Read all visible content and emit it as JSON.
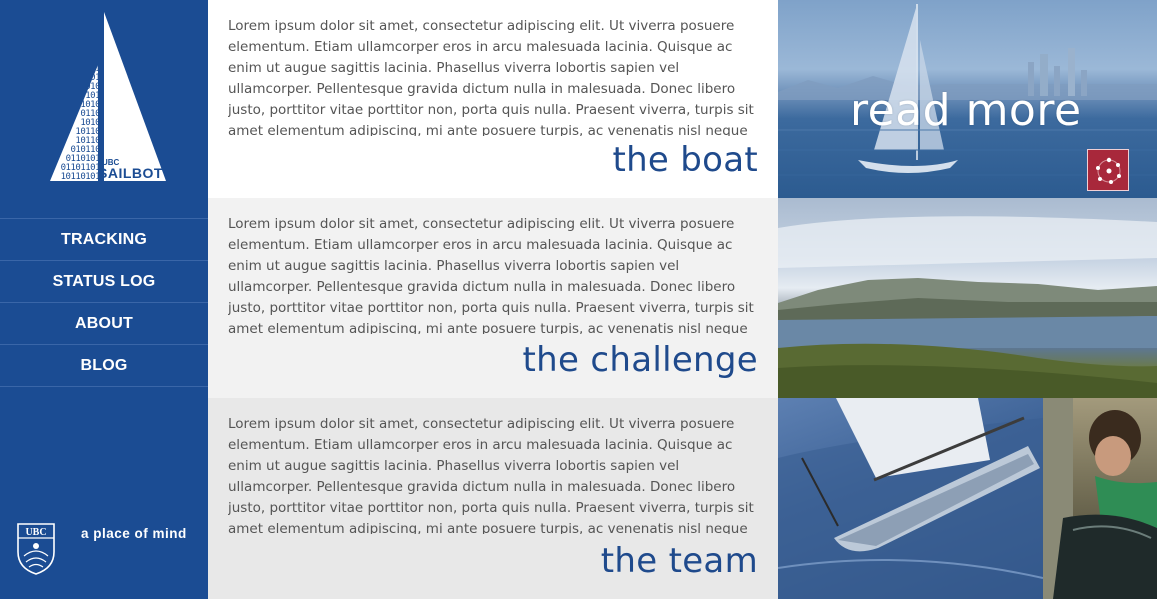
{
  "logo": {
    "small_text": "UBC",
    "word": "SAILBOT",
    "binary_lines": [
      "1",
      "01",
      "010",
      "101",
      "1010",
      "0110",
      "1010",
      "10110",
      "10110",
      "010110",
      "0110101",
      "01101101",
      "10110101"
    ]
  },
  "nav": {
    "items": [
      {
        "label": "TRACKING"
      },
      {
        "label": "STATUS LOG"
      },
      {
        "label": "ABOUT"
      },
      {
        "label": "BLOG"
      }
    ]
  },
  "footer": {
    "crest_text": "UBC",
    "tagline": "a place of mind"
  },
  "sections": {
    "boat": {
      "title": "the boat",
      "body": "Lorem ipsum dolor sit amet, consectetur adipiscing elit. Ut viverra posuere elementum. Etiam ullamcorper eros in arcu malesuada lacinia. Quisque ac enim ut augue sagittis lacinia. Phasellus viverra lobortis sapien vel ullamcorper. Pellentesque gravida dictum nulla in malesuada. Donec libero justo, porttitor vitae porttitor non, porta quis nulla. Praesent viverra, turpis sit amet elementum adipiscing, mi ante posuere turpis, ac venenatis nisl neque"
    },
    "challenge": {
      "title": "the challenge",
      "body": "Lorem ipsum dolor sit amet, consectetur adipiscing elit. Ut viverra posuere elementum. Etiam ullamcorper eros in arcu malesuada lacinia. Quisque ac enim ut augue sagittis lacinia. Phasellus viverra lobortis sapien vel ullamcorper. Pellentesque gravida dictum nulla in malesuada. Donec libero justo, porttitor vitae porttitor non, porta quis nulla. Praesent viverra, turpis sit amet elementum adipiscing, mi ante posuere turpis, ac venenatis nisl neque"
    },
    "team": {
      "title": "the team",
      "body": "Lorem ipsum dolor sit amet, consectetur adipiscing elit. Ut viverra posuere elementum. Etiam ullamcorper eros in arcu malesuada lacinia. Quisque ac enim ut augue sagittis lacinia. Phasellus viverra lobortis sapien vel ullamcorper. Pellentesque gravida dictum nulla in malesuada. Donec libero justo, porttitor vitae porttitor non, porta quis nulla. Praesent viverra, turpis sit amet elementum adipiscing, mi ante posuere turpis, ac venenatis nisl neque"
    }
  },
  "hero": {
    "read_more": "read more"
  },
  "icons": {
    "badge": "network-dots-icon",
    "crest": "ubc-crest-icon"
  },
  "colors": {
    "brand_blue": "#1b4c93",
    "heading_blue": "#1f4a8c",
    "badge_red": "#a8283b"
  }
}
